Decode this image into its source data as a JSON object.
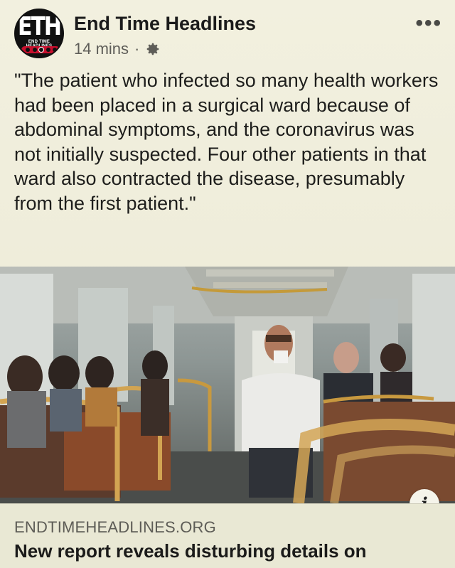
{
  "post": {
    "page_name": "End Time Headlines",
    "avatar": {
      "initials": "ETH",
      "subtitle": "END TIME HEADLINES"
    },
    "timestamp": "14 mins",
    "separator": "·",
    "audience_icon": "gear-icon",
    "more_icon": "more-options-icon",
    "more_label": "•••",
    "text": "\"The patient who infected so many health workers had been placed in a surgical ward because of abdominal symptoms, and the coronavirus was not initially suspected. Four other patients in that ward also contracted the disease, presumably from the first patient.\""
  },
  "link_preview": {
    "domain": "ENDTIMEHEADLINES.ORG",
    "headline": "New report reveals disturbing details on",
    "info_icon": "info-icon",
    "info_label": "i"
  },
  "colors": {
    "background": "#eeedd9",
    "brand_red": "#c8102e",
    "text": "#1d1d1b",
    "muted": "#5e5d58"
  }
}
